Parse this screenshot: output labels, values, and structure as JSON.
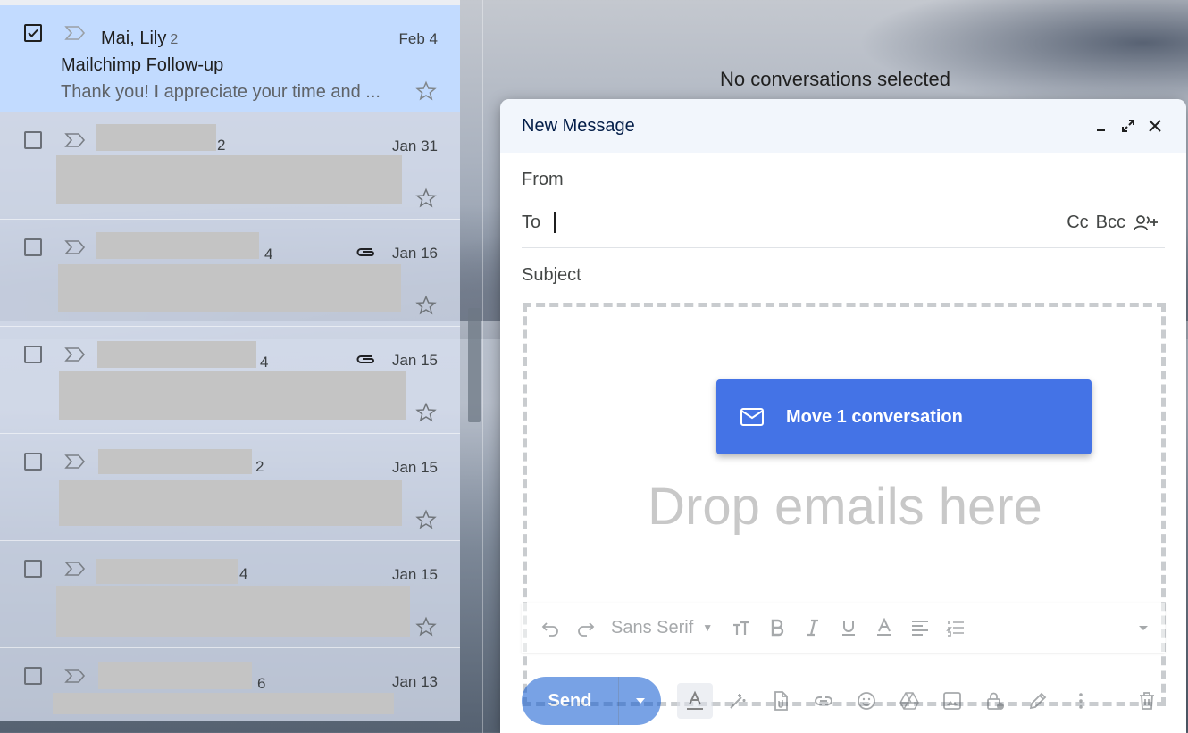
{
  "inbox": {
    "rows": [
      {
        "sender": "Mai, Lily",
        "count": "2",
        "date": "Feb 4",
        "subject": "Mailchimp Follow-up",
        "snippet": "Thank you! I appreciate your time and ...",
        "selected": true
      },
      {
        "count": "2",
        "date": "Jan 31"
      },
      {
        "count": "4",
        "date": "Jan 16",
        "attachment": true
      },
      {
        "count": "4",
        "date": "Jan 15",
        "attachment": true
      },
      {
        "count": "2",
        "date": "Jan 15"
      },
      {
        "count": "4",
        "date": "Jan 15"
      },
      {
        "count": "6",
        "date": "Jan 13"
      }
    ]
  },
  "reading_pane": {
    "empty_text": "No conversations selected"
  },
  "compose": {
    "title": "New Message",
    "from_label": "From",
    "to_label": "To",
    "cc_label": "Cc",
    "bcc_label": "Bcc",
    "subject_placeholder": "Subject",
    "drop_text": "Drop emails here",
    "move_label": "Move 1 conversation",
    "font_name": "Sans Serif",
    "send_label": "Send"
  },
  "icons": {
    "checkbox": "checkbox-checked-icon",
    "importance": "importance-marker-icon",
    "star": "star-outline-icon",
    "attachment": "paperclip-icon",
    "minimize": "minimize-icon",
    "expand": "expand-icon",
    "close": "close-icon",
    "add_recipients": "add-people-icon",
    "mail": "mail-icon"
  },
  "colors": {
    "selected_row": "#c2dbff",
    "move_card": "#4473e6",
    "send_button": "#0b57d0",
    "compose_header": "#f2f6fc"
  }
}
